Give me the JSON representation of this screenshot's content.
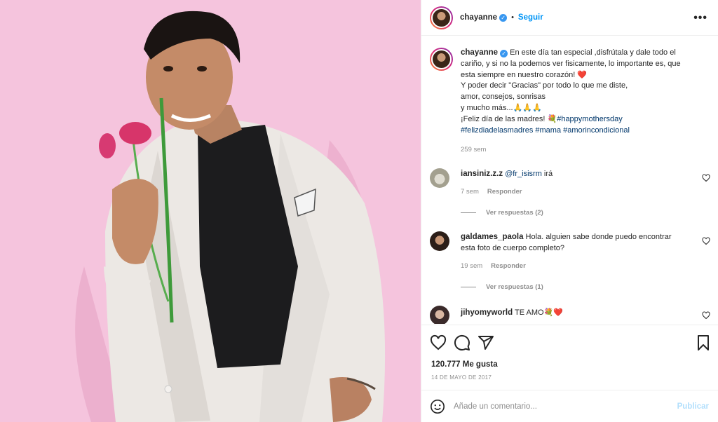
{
  "header": {
    "username": "chayanne",
    "verified_icon": "verified-badge-icon",
    "separator": "•",
    "follow_label": "Seguir",
    "more_label": "•••"
  },
  "caption": {
    "username": "chayanne",
    "lines": [
      "En este día tan especial ,disfrútala y dale todo el",
      "cariño, y si no la podemos ver fisicamente, lo importante es, que",
      "esta siempre en nuestro corazón! ❤️",
      "Y poder decir \"Gracias\" por todo lo que me diste,",
      "amor, consejos, sonrisas",
      "y mucho más...🙏🙏🙏",
      "¡Feliz día de las madres! 💐"
    ],
    "hashtags": [
      "#happymothersday",
      "#felizdiadelasmadres",
      "#mama",
      "#amorincondicional"
    ],
    "time": "259 sem"
  },
  "comments": [
    {
      "username": "iansiniz.z.z",
      "mention": "@fr_isisrm",
      "text": "irá",
      "time": "7 sem",
      "reply_label": "Responder",
      "view_replies": "Ver respuestas (2)"
    },
    {
      "username": "galdames_paola",
      "text": "Hola. alguien sabe donde puedo encontrar",
      "text2": "esta foto de cuerpo completo?",
      "time": "19 sem",
      "reply_label": "Responder",
      "view_replies": "Ver respuestas (1)"
    },
    {
      "username": "jihyomyworld",
      "text": "TE AMO💐❤️"
    }
  ],
  "stats": {
    "likes": "120.777 Me gusta",
    "date": "14 DE MAYO DE 2017"
  },
  "composer": {
    "placeholder": "Añade un comentario...",
    "publish_label": "Publicar"
  },
  "colors": {
    "accent": "#0095f6",
    "photo_background": "#f4c3dc",
    "muted": "#8e8e8e",
    "hashtag": "#00376b"
  }
}
